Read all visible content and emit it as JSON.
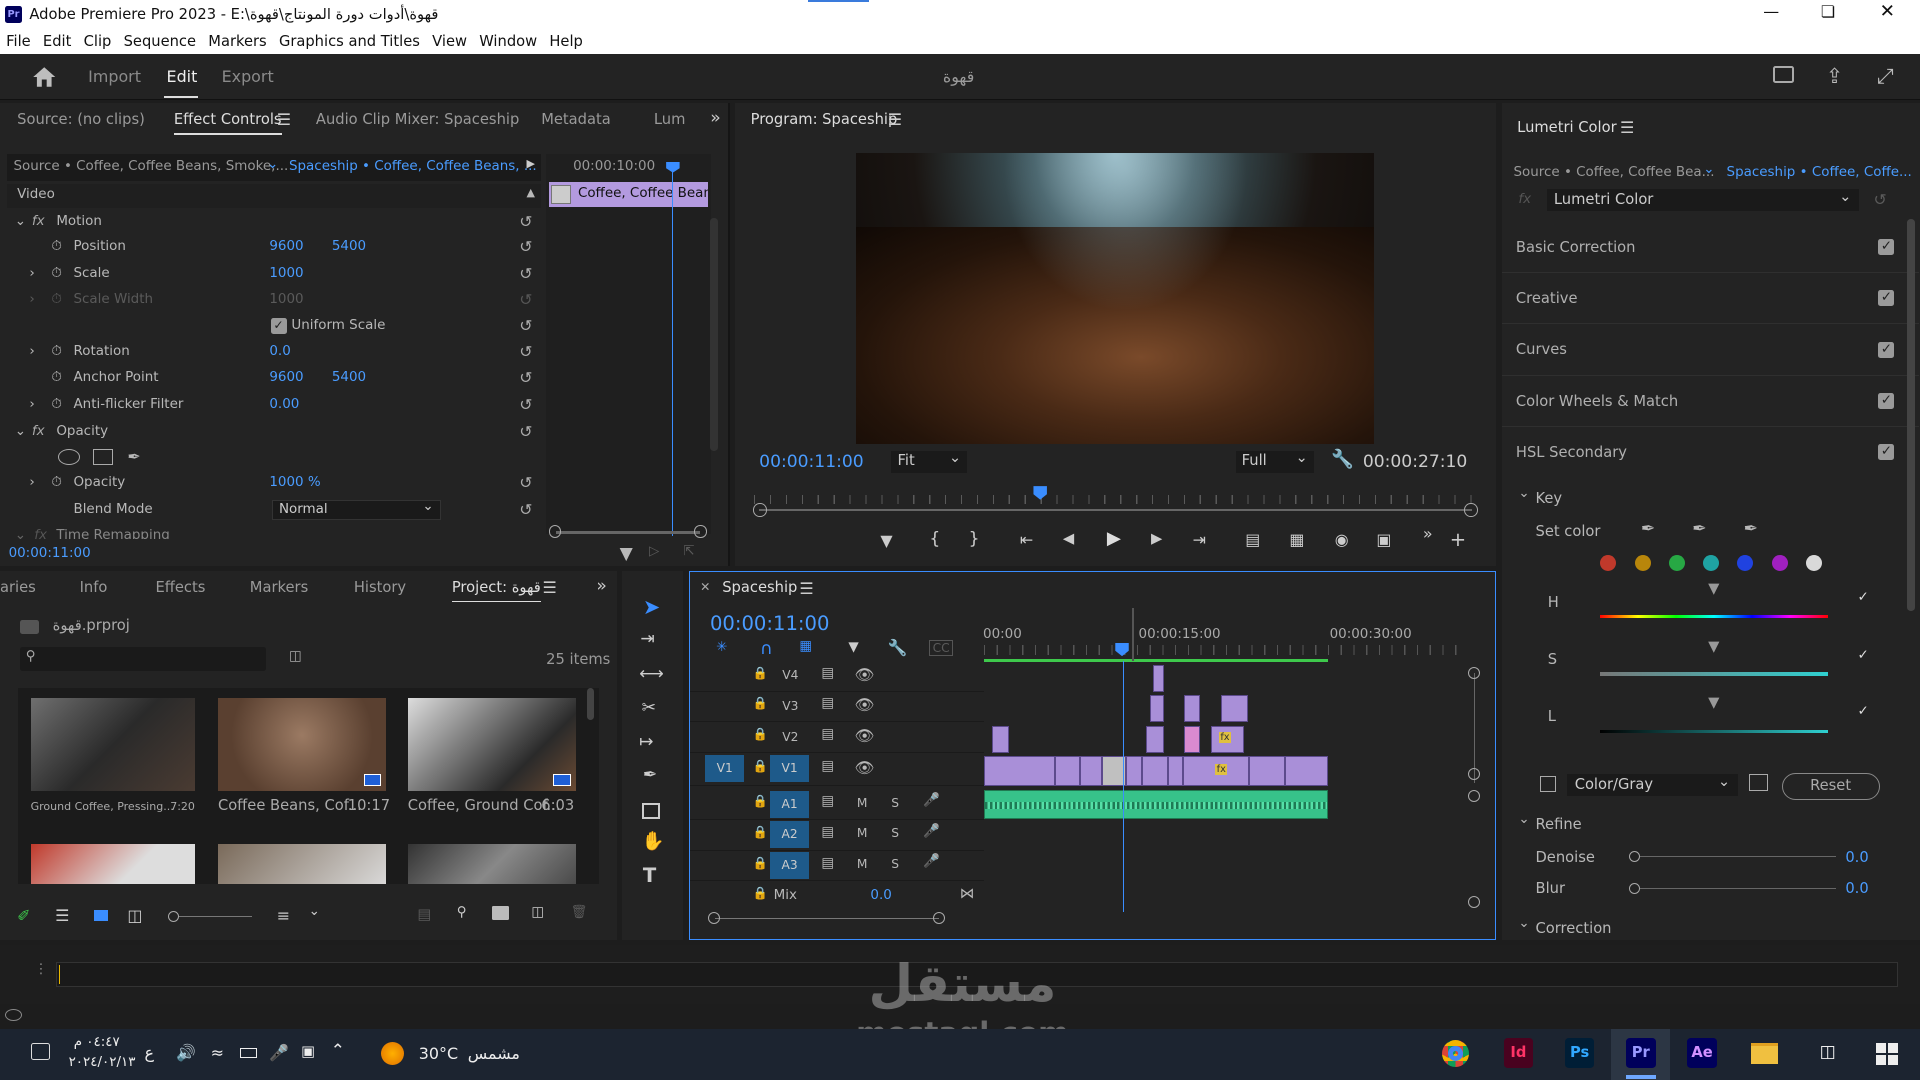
{
  "window": {
    "title": "Adobe Premiere Pro 2023 - E:\\قهوة\\أدوات دورة المونتاج\\قهوة",
    "pr_badge": "Pr"
  },
  "menu": [
    "File",
    "Edit",
    "Clip",
    "Sequence",
    "Markers",
    "Graphics and Titles",
    "View",
    "Window",
    "Help"
  ],
  "header": {
    "import": "Import",
    "edit": "Edit",
    "export": "Export",
    "project_name": "قهوة"
  },
  "source_panel": {
    "tabs": [
      "Source: (no clips)",
      "Effect Controls",
      "Audio Clip Mixer: Spaceship",
      "Metadata",
      "Lum"
    ],
    "source_path": "Source • Coffee, Coffee Beans, Smoke,...",
    "sequence_path": "Spaceship • Coffee, Coffee Beans, ...",
    "mini_time": "00:00:10:00",
    "mini_clip": "Coffee, Coffee Beans,",
    "video_label": "Video",
    "motion": "Motion",
    "position_label": "Position",
    "position_x": "9600",
    "position_y": "5400",
    "scale_label": "Scale",
    "scale_value": "1000",
    "scale_width_label": "Scale Width",
    "scale_width_value": "1000",
    "uniform_scale": "Uniform Scale",
    "rotation_label": "Rotation",
    "rotation_value": "0.0",
    "anchor_label": "Anchor Point",
    "anchor_x": "9600",
    "anchor_y": "5400",
    "antiflicker_label": "Anti-flicker Filter",
    "antiflicker_value": "0.00",
    "opacity_section": "Opacity",
    "opacity_label": "Opacity",
    "opacity_value": "1000 %",
    "blend_label": "Blend Mode",
    "blend_value": "Normal",
    "time_remap": "Time Remapping",
    "footer_time": "00:00:11:00"
  },
  "program": {
    "title": "Program: Spaceship",
    "current_time": "00:00:11:00",
    "fit": "Fit",
    "quality": "Full",
    "duration": "00:00:27:10"
  },
  "project_panel": {
    "tabs": [
      "aries",
      "Info",
      "Effects",
      "Markers",
      "History",
      "Project: قهوة"
    ],
    "file": "قهوة.prproj",
    "items_count": "25 items",
    "thumbs": [
      {
        "name": "Ground Coffee, Pressing...",
        "dur": "7:20"
      },
      {
        "name": "Coffee Beans, Cof...",
        "dur": "10:17"
      },
      {
        "name": "Coffee, Ground Cof...",
        "dur": "6:03"
      }
    ]
  },
  "timeline": {
    "title": "Spaceship",
    "timecode": "00:00:11:00",
    "ruler": [
      "00:00",
      "00:00:15:00",
      "00:00:30:00"
    ],
    "video_tracks": [
      "V4",
      "V3",
      "V2",
      "V1"
    ],
    "audio_tracks": [
      "A1",
      "A2",
      "A3"
    ],
    "source_patch": "V1",
    "mix_label": "Mix",
    "mix_value": "0.0",
    "m": "M",
    "s": "S"
  },
  "lumetri": {
    "title": "Lumetri Color",
    "source": "Source • Coffee, Coffee Bea...",
    "sequence": "Spaceship • Coffee, Coffe...",
    "effect": "Lumetri Color",
    "sections": [
      "Basic Correction",
      "Creative",
      "Curves",
      "Color Wheels & Match",
      "HSL Secondary"
    ],
    "key": "Key",
    "set_color": "Set color",
    "swatches": [
      "#c0392b",
      "#b8860b",
      "#27a844",
      "#1fa3a3",
      "#2042e0",
      "#a020c0",
      "#d9d9d9"
    ],
    "h": "H",
    "s": "S",
    "l": "L",
    "color_gray": "Color/Gray",
    "reset": "Reset",
    "refine": "Refine",
    "denoise": "Denoise",
    "denoise_value": "0.0",
    "blur": "Blur",
    "blur_value": "0.0",
    "correction": "Correction"
  },
  "taskbar": {
    "time": "٠٤:٤٧ م",
    "date": "٢٠٢٤/٠٢/١٣",
    "lang": "ع",
    "weather": "30°C",
    "weather_label": "مشمس",
    "apps": [
      "Id",
      "Ps",
      "Pr",
      "Ae"
    ]
  },
  "watermark": {
    "arabic": "مستقل",
    "latin": "mostaql.com"
  }
}
